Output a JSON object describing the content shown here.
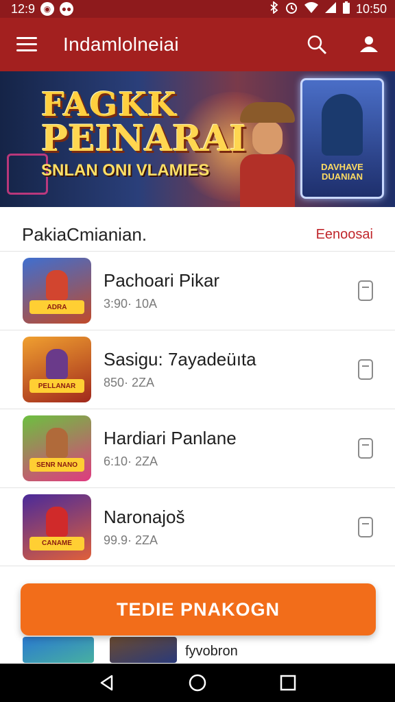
{
  "status_bar": {
    "left_time": "12:9",
    "right_time": "10:50",
    "bg_color": "#8e1a1c"
  },
  "app_bar": {
    "title": "Indamlolneiai",
    "bg_color": "#a3201f",
    "icons": [
      "menu-icon",
      "search-icon",
      "account-icon"
    ]
  },
  "banner": {
    "title_line1": "FAGKK",
    "title_line2": "PEINARAI",
    "subtitle": "SNLAN ONI VLAMIES",
    "card_label": "DAVHAVE DUANIAN"
  },
  "section": {
    "title": "PakiaCmianian.",
    "link": "Eenoosai",
    "accent": "#c0262b"
  },
  "games": [
    {
      "name": "Pachoari Pikar",
      "meta": "3:90· 10A",
      "thumb_label": "ADRA"
    },
    {
      "name": "Sasigu: 7ayadeüıta",
      "meta": "850· 2ZA",
      "thumb_label": "PELLANAR"
    },
    {
      "name": "Hardiari Panlane",
      "meta": "6:10· 2ZA",
      "thumb_label": "SENR NANO"
    },
    {
      "name": "Naronajoš",
      "meta": "99.9· 2ZA",
      "thumb_label": "CANAME"
    }
  ],
  "cta": {
    "label": "TEDIE PNAKOGN",
    "color": "#f26d1a"
  },
  "peek": {
    "name": "fyvobron"
  },
  "nav": [
    "back-icon",
    "home-icon",
    "recents-icon"
  ]
}
